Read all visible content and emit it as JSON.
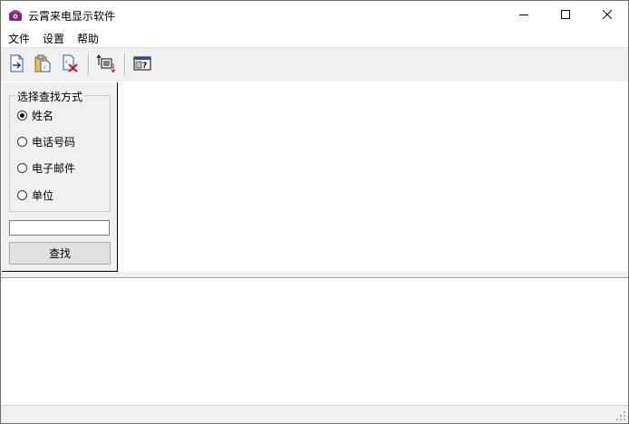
{
  "window": {
    "title": "云霄来电显示软件",
    "controls": {
      "minimize": "minimize-icon",
      "maximize": "maximize-icon",
      "close": "close-icon"
    }
  },
  "menu": {
    "file": "文件",
    "settings": "设置",
    "help": "帮助"
  },
  "toolbar": {
    "icons": [
      "import-icon",
      "paste-icon",
      "delete-icon",
      "sort-icon",
      "about-icon"
    ]
  },
  "search_panel": {
    "group_title": "选择查找方式",
    "options": [
      "姓名",
      "电话号码",
      "电子邮件",
      "单位"
    ],
    "selected": "姓名",
    "input_value": "",
    "button_label": "查找"
  },
  "colors": {
    "panel_bg": "#f0f0f0",
    "content_bg": "#ffffff",
    "app_icon": "#7a2a7a"
  }
}
